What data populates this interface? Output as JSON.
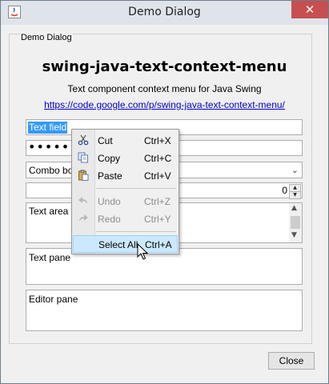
{
  "window": {
    "title": "Demo Dialog",
    "close_glyph": "✕"
  },
  "group": {
    "legend": "Demo Dialog"
  },
  "header": {
    "heading": "swing-java-text-context-menu",
    "subtitle": "Text component context menu for Java Swing",
    "link": "https://code.google.com/p/swing-java-text-context-menu/"
  },
  "fields": {
    "text_field": "Text field",
    "password_dots": "•••••••",
    "combo_box": "Combo box",
    "spinner_value": "0",
    "text_area": "Text area",
    "text_pane": "Text pane",
    "editor_pane": "Editor pane"
  },
  "context_menu": {
    "items": [
      {
        "label": "Cut",
        "accel": "Ctrl+X",
        "icon": "scissors-icon",
        "enabled": true
      },
      {
        "label": "Copy",
        "accel": "Ctrl+C",
        "icon": "copy-icon",
        "enabled": true
      },
      {
        "label": "Paste",
        "accel": "Ctrl+V",
        "icon": "paste-icon",
        "enabled": true
      },
      {
        "label": "Undo",
        "accel": "Ctrl+Z",
        "icon": "undo-icon",
        "enabled": false
      },
      {
        "label": "Redo",
        "accel": "Ctrl+Y",
        "icon": "redo-icon",
        "enabled": false
      },
      {
        "label": "Select All",
        "accel": "Ctrl+A",
        "icon": "",
        "enabled": true,
        "selected": true
      }
    ]
  },
  "buttons": {
    "close": "Close"
  },
  "colors": {
    "selection": "#3399ff",
    "menu_highlight": "#cce8ff",
    "link": "#0000cc",
    "title_close": "#c74f4f"
  }
}
